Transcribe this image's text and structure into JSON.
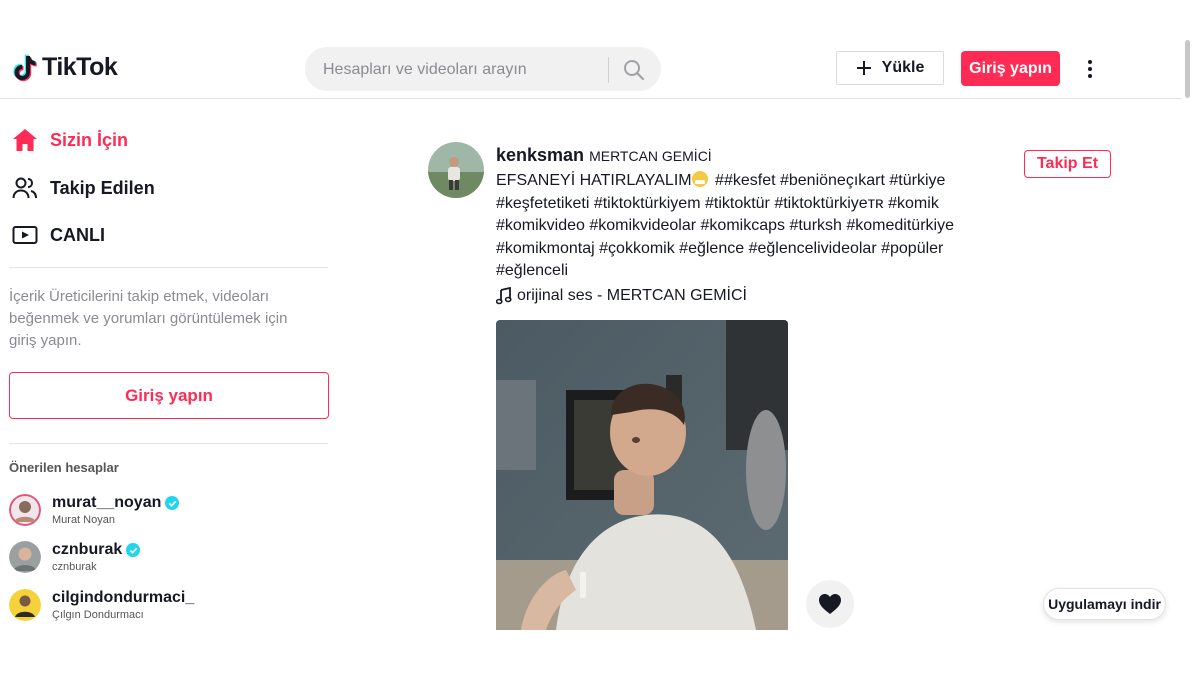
{
  "header": {
    "logo_text": "TikTok",
    "search_placeholder": "Hesapları ve videoları arayın",
    "upload_label": "Yükle",
    "login_label": "Giriş yapın",
    "brand_color": "#fe2c55"
  },
  "sidebar": {
    "nav": [
      {
        "label": "Sizin İçin",
        "icon": "home-icon",
        "active": true
      },
      {
        "label": "Takip Edilen",
        "icon": "users-icon",
        "active": false
      },
      {
        "label": "CANLI",
        "icon": "live-icon",
        "active": false
      }
    ],
    "login_prompt": "İçerik Üreticilerini takip etmek, videoları beğenmek ve yorumları görüntülemek için giriş yapın.",
    "login_button": "Giriş yapın",
    "suggested_title": "Önerilen hesaplar",
    "accounts": [
      {
        "username": "murat__noyan",
        "name": "Murat Noyan",
        "verified": true
      },
      {
        "username": "cznburak",
        "name": "cznburak",
        "verified": true
      },
      {
        "username": "cilgindondurmaci_",
        "name": "Çılgın Dondurmacı",
        "verified": false
      }
    ]
  },
  "post": {
    "username": "kenksman",
    "display_name": "MERTCAN GEMİCİ",
    "caption_start": "EFSANEYİ HATIRLAYALIM",
    "caption_rest": " ##kesfet #beniöneçıkart #türkiye #keşfetetiketi #tiktoktürkiyem #tiktoktür #tiktoktürkiyeᴛʀ #komik #komikvideo #komikvideolar #komikcaps #turksh #komeditürkiye #komikmontaj #çokkomik #eğlence #eğlencelivideolar #popüler #eğlenceli",
    "music": "orijinal ses - MERTCAN GEMİCİ",
    "follow_label": "Takip Et"
  },
  "app_download_label": "Uygulamayı indir"
}
